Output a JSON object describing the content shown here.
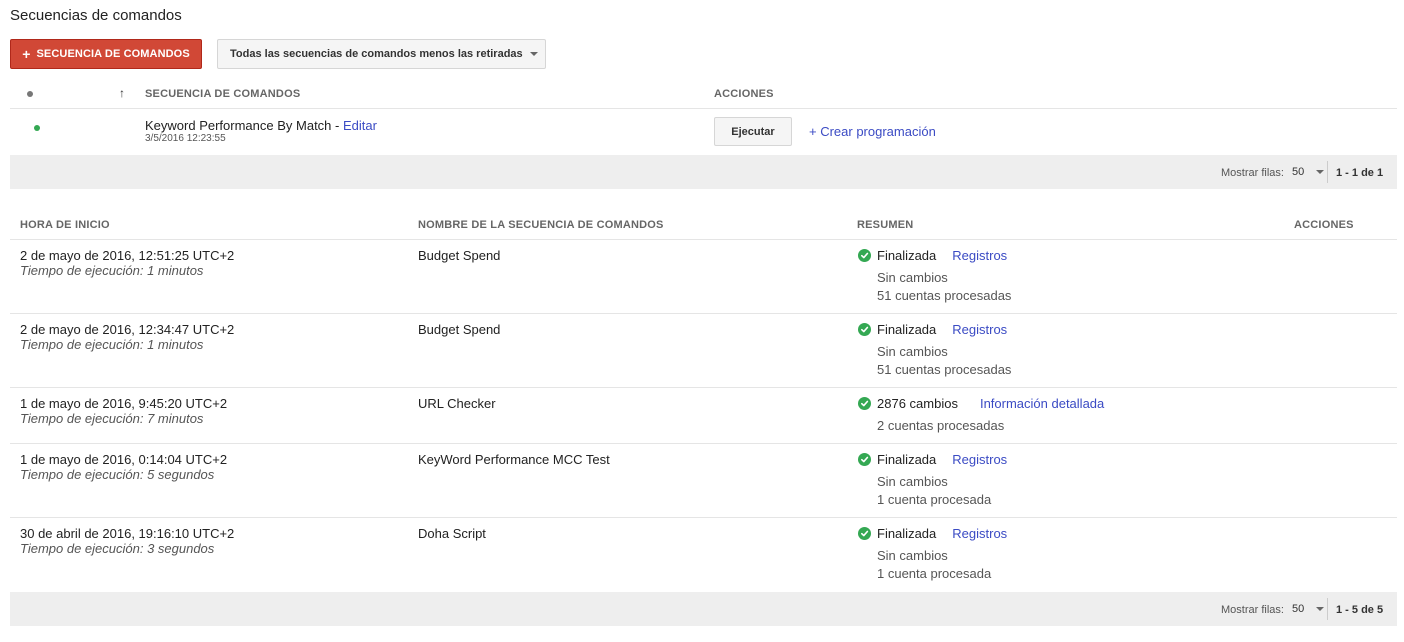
{
  "page": {
    "title": "Secuencias de comandos"
  },
  "toolbar": {
    "new_label": "SECUENCIA DE COMANDOS",
    "filter_label": "Todas las secuencias de comandos menos las retiradas"
  },
  "scripts_table": {
    "headers": {
      "script": "SECUENCIA DE COMANDOS",
      "actions": "ACCIONES"
    },
    "rows": [
      {
        "name": "Keyword Performance By Match",
        "separator": "-",
        "edit_label": "Editar",
        "date": "3/5/2016 12:23:55",
        "execute_label": "Ejecutar",
        "schedule_label": "+ Crear programación",
        "status_color": "#34a853"
      }
    ],
    "pager": {
      "label": "Mostrar filas:",
      "value": "50",
      "range": "1 - 1 de 1"
    }
  },
  "history_table": {
    "headers": {
      "start": "HORA DE INICIO",
      "name": "NOMBRE DE LA SECUENCIA DE COMANDOS",
      "summary": "RESUMEN",
      "actions": "ACCIONES"
    },
    "rows": [
      {
        "start": "2 de mayo de 2016, 12:51:25 UTC+2",
        "duration": "Tiempo de ejecución: 1 minutos",
        "name": "Budget Spend",
        "status": "Finalizada",
        "link": "Registros",
        "line1": "Sin cambios",
        "line2": "51 cuentas procesadas"
      },
      {
        "start": "2 de mayo de 2016, 12:34:47 UTC+2",
        "duration": "Tiempo de ejecución: 1 minutos",
        "name": "Budget Spend",
        "status": "Finalizada",
        "link": "Registros",
        "line1": "Sin cambios",
        "line2": "51 cuentas procesadas"
      },
      {
        "start": "1 de mayo de 2016, 9:45:20 UTC+2",
        "duration": "Tiempo de ejecución: 7 minutos",
        "name": "URL Checker",
        "status": "2876 cambios",
        "link": "Información detallada",
        "line1": "2 cuentas procesadas",
        "line2": ""
      },
      {
        "start": "1 de mayo de 2016, 0:14:04 UTC+2",
        "duration": "Tiempo de ejecución: 5 segundos",
        "name": "KeyWord Performance MCC Test",
        "status": "Finalizada",
        "link": "Registros",
        "line1": "Sin cambios",
        "line2": "1 cuenta procesada"
      },
      {
        "start": "30 de abril de 2016, 19:16:10 UTC+2",
        "duration": "Tiempo de ejecución: 3 segundos",
        "name": "Doha Script",
        "status": "Finalizada",
        "link": "Registros",
        "line1": "Sin cambios",
        "line2": "1 cuenta procesada"
      }
    ],
    "pager": {
      "label": "Mostrar filas:",
      "value": "50",
      "range": "1 - 5 de 5"
    }
  },
  "colors": {
    "accent": "#d14836",
    "link": "#3b4bc4",
    "success": "#34a853"
  }
}
